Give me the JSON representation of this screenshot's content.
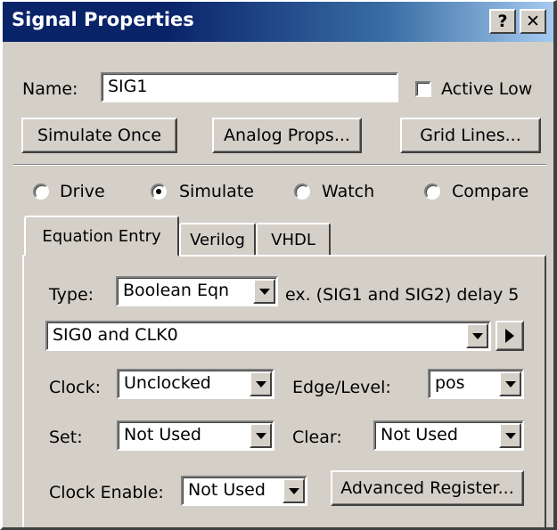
{
  "window": {
    "title": "Signal Properties",
    "help_glyph": "?",
    "close_glyph": "✕"
  },
  "name_row": {
    "label": "Name:",
    "value": "SIG1",
    "active_low_label": "Active Low",
    "active_low_checked": false
  },
  "buttons": {
    "simulate_once": "Simulate Once",
    "analog_props": "Analog Props...",
    "grid_lines": "Grid Lines..."
  },
  "modes": [
    {
      "label": "Drive",
      "selected": false
    },
    {
      "label": "Simulate",
      "selected": true
    },
    {
      "label": "Watch",
      "selected": false
    },
    {
      "label": "Compare",
      "selected": false
    }
  ],
  "tabs": [
    {
      "label": "Equation Entry",
      "active": true
    },
    {
      "label": "Verilog",
      "active": false
    },
    {
      "label": "VHDL",
      "active": false
    }
  ],
  "equation": {
    "type_label": "Type:",
    "type_value": "Boolean Eqn",
    "example": "ex. (SIG1 and SIG2) delay 5",
    "expression": "SIG0 and CLK0",
    "play_icon": "play-arrow-icon"
  },
  "clock": {
    "label": "Clock:",
    "value": "Unclocked"
  },
  "edge": {
    "label": "Edge/Level:",
    "value": "pos"
  },
  "set": {
    "label": "Set:",
    "value": "Not Used"
  },
  "clear": {
    "label": "Clear:",
    "value": "Not Used"
  },
  "clock_enable": {
    "label": "Clock Enable:",
    "value": "Not Used"
  },
  "advanced_register": "Advanced Register...",
  "colors": {
    "titlebar": "#0a246a",
    "face": "#d4d0c8"
  }
}
